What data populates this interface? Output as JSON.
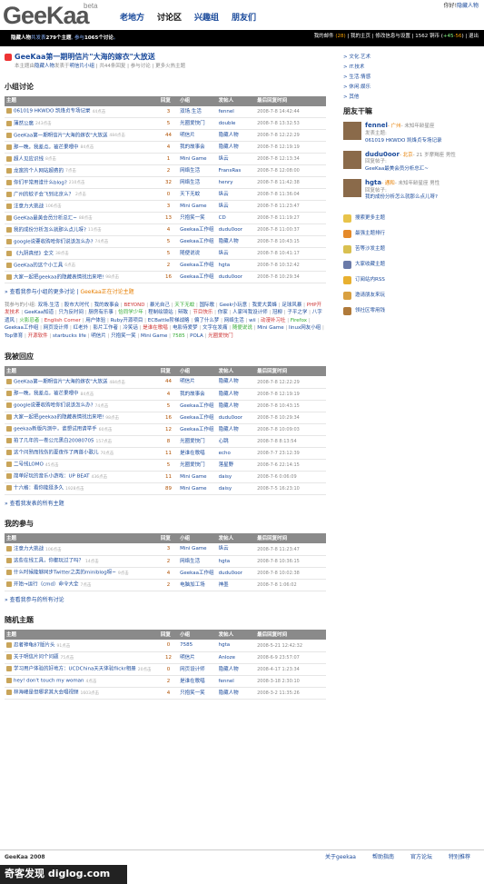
{
  "header": {
    "logo": "GeeKaa",
    "beta": "beta",
    "nav": [
      "老地方",
      "讨论区",
      "兴趣组",
      "朋友们"
    ],
    "greeting": "你好!",
    "user": "隐藏人物"
  },
  "userbar": {
    "left_user": "隐藏人物",
    "left_a": "共发表",
    "left_b": "279个主题",
    "left_c": ", 参与",
    "left_d": "1065个讨论",
    "left_e": "。",
    "mail": "我的邮件",
    "mail_count": "(28)",
    "links": "| 我的主页 | 修改信息与设置 | ",
    "coins": "1562",
    "coins_label": " 铜币 (",
    "delta": "+45",
    "delta2": "-56",
    "end": ") | 退出"
  },
  "topic": {
    "title": "GeeKaa第一期明信片\"大海的嫁衣\"大放送",
    "meta_prefix": "本主题由",
    "meta_user": "隐藏人物",
    "meta_in": "发表于",
    "meta_group": "明信片小组",
    "meta_rest": " | 共44条回复 | 参与讨论 | 更多火热主题"
  },
  "sections": {
    "group": "小组讨论",
    "replied": "我被回应",
    "joined": "我的参与",
    "random": "随机主题"
  },
  "columns": [
    "主题",
    "回复",
    "小组",
    "发帖人",
    "最后回复时间"
  ],
  "group_rows": [
    [
      "061019 HKWDO 凯烽贞专场记录",
      "44点击",
      "3",
      "双场.生活",
      "fennel",
      "2008-7-8 14:42:44"
    ],
    [
      "薄然公腐",
      "243点击",
      "5",
      "光圈爱快门",
      "double",
      "2008-7-8 13:32:53"
    ],
    [
      "GeeKaa第一期明信片\"大海的嫁衣\"大放送",
      "484点击",
      "44",
      "明信片",
      "隐藏人物",
      "2008-7-8 12:22:29"
    ],
    [
      "那一晚，我差点。被芒果喂中",
      "84点击",
      "4",
      "我的故事会",
      "隐藏人物",
      "2008-7-8 12:19:19"
    ],
    [
      "超人见应识线",
      "8点击",
      "1",
      "Mini Game",
      "纵云",
      "2008-7-8 12:13:34"
    ],
    [
      "龙宽的个人网站超费的",
      "7点击",
      "2",
      "网络生活",
      "FransRas",
      "2008-7-8 12:08:00"
    ],
    [
      "你们平常用谁什么blog?",
      "210点击",
      "32",
      "网络生活",
      "henry",
      "2008-7-8 11:42:38"
    ],
    [
      "广州的蚊子会飞到北京么？",
      "2点击",
      "0",
      "天下无蚊",
      "纵云",
      "2008-7-8 11:36:04"
    ],
    [
      "注意力大挑战",
      "106点击",
      "3",
      "Mini Game",
      "纵云",
      "2008-7-8 11:23:47"
    ],
    [
      "GeeKaa最美会员分析总汇~",
      "88点击",
      "13",
      "只抱笑一笑",
      "CD",
      "2008-7-8 11:19:27"
    ],
    [
      "我的成份分析怎么就那么点儿呀?",
      "11点击",
      "4",
      "Geekaa工作组",
      "dudu0oor",
      "2008-7-8 11:00:37"
    ],
    [
      "google说要收购哈你们说该怎么办?",
      "74点击",
      "5",
      "Geekaa工作组",
      "隐藏人物",
      "2008-7-8 10:43:15"
    ],
    [
      "《九阴真经》全文",
      "38点击",
      "5",
      "随便说说",
      "纵云",
      "2008-7-8 10:41:17"
    ],
    [
      "GeeKaa的这个小工具",
      "6点击",
      "2",
      "Geekaa工作组",
      "hgta",
      "2008-7-8 10:32:42"
    ],
    [
      "大家一起把geekaa的隐藏表情找出来吧!",
      "98点击",
      "16",
      "Geekaa工作组",
      "dudu0oor",
      "2008-7-8 10:29:34"
    ]
  ],
  "group_more": "查看我参与小组的更多讨论",
  "group_link": "GeeKaa正在讨论主题",
  "tags": {
    "label": "我参与的小组:",
    "items": [
      "双场.生活",
      "股市大时代",
      "我的故事会",
      "BEYOND",
      "暴光自己",
      "天下无蚊",
      "国际歌",
      "Geek小玩意",
      "我爱大黄蜂",
      "足球风暴",
      "PHP开发技术",
      "GeeKaa知道",
      "只为反时间",
      "厨房有乐事",
      "恰同学少年",
      "程制绘镜站",
      "辩致",
      "节目快乐",
      "你家",
      "人家叫我设计师",
      "冠柳",
      "子平之学",
      "八字遗风",
      "火影忍者",
      "English Corner",
      "用户体验",
      "Ruby开源项目",
      "ECBattle阶梯战略",
      "偏了什么梦",
      "网络生活",
      "wii",
      "动漫补习社",
      "Firefox",
      "Geekaa工作组",
      "网页设计师",
      "红老外",
      "影片工作者",
      "冷笑话",
      "是谁在歌唱",
      "电影侍爱梦",
      "文字在发痛",
      "随便说说",
      "Mini Game",
      "linux网友小组",
      "Top体育",
      "开源软件",
      "starbucks life",
      "明信片",
      "只抱笑一笑",
      "Mini Game",
      "7585",
      "POLA",
      "光圈爱快门"
    ]
  },
  "replied_rows": [
    [
      "GeeKaa第一期明信片\"大海的嫁衣\"大放送",
      "484点击",
      "44",
      "明信片",
      "隐藏人物",
      "2008-7-8 12:22:29"
    ],
    [
      "那一晚，我差点。被芒果喂中",
      "84点击",
      "4",
      "我的故事会",
      "隐藏人物",
      "2008-7-8 12:19:19"
    ],
    [
      "google说要收购哈你们说该怎么办?",
      "74点击",
      "5",
      "Geekaa工作组",
      "隐藏人物",
      "2008-7-8 10:43:15"
    ],
    [
      "大家一起把geekaa的隐藏表情找出来吧!",
      "98点击",
      "16",
      "Geekaa工作组",
      "dudu0oor",
      "2008-7-8 10:29:34"
    ],
    [
      "geekaa新版内测中，谁想试用请举手",
      "60点击",
      "12",
      "Geekaa工作组",
      "隐藏人物",
      "2008-7-8 10:09:03"
    ],
    [
      "拍了几年的一卷公元黑白20080705",
      "157点击",
      "8",
      "光圈爱快门",
      "心跳",
      "2008-7-8 8:13:54"
    ],
    [
      "这个问熟而找伤的夏夜作了两首小歌儿",
      "70点击",
      "11",
      "是谁在歌唱",
      "echo",
      "2008-7-7 23:12:39"
    ],
    [
      "二号线LOMO",
      "45点击",
      "5",
      "光圈爱快门",
      "落星野",
      "2008-7-6 22:14:15"
    ],
    [
      "简单好玩的音乐小游戏：UP BEAT",
      "436点击",
      "11",
      "Mini Game",
      "daisy",
      "2008-7-6 0:06:09"
    ],
    [
      "十六格：看你能挺多久",
      "1928点击",
      "89",
      "Mini Game",
      "daisy",
      "2008-7-5 16:23:10"
    ]
  ],
  "replied_more": "查看我发表的所有主题",
  "joined_rows": [
    [
      "注意力大挑战",
      "106点击",
      "3",
      "Mini Game",
      "纵云",
      "2008-7-8 11:23:47"
    ],
    [
      "这些在线工具，你都玩过了吗？",
      "14点击",
      "2",
      "网络生活",
      "hgta",
      "2008-7-8 10:36:15"
    ],
    [
      "什么时候能够同步Twitter之类的miniblog呀~",
      "9点击",
      "4",
      "Geekaa工作组",
      "dudu0oor",
      "2008-7-8 10:02:38"
    ],
    [
      "开始→运行（cmd）命令大全",
      "7点击",
      "2",
      "电脑加工场",
      "神墨",
      "2008-7-8 1:06:02"
    ]
  ],
  "joined_more": "查看我参与的所有讨论",
  "random_rows": [
    [
      "忍者神龟87版片头",
      "91点击",
      "0",
      "7585",
      "hgta",
      "2008-5-21 12:42:32"
    ],
    [
      "关于明信片问个问题",
      "75点击",
      "12",
      "明信片",
      "Anloze",
      "2008-6-9 23:57:07"
    ],
    [
      "学习用户体验的好地方：UCDChina天天体验flickr相册",
      "20点击",
      "0",
      "网页设计师",
      "隐藏人物",
      "2008-4-17 1:23:34"
    ],
    [
      "hey! don't touch my woman",
      "4点击",
      "2",
      "是谁在歌唱",
      "fennel",
      "2008-3-18 2:30:10"
    ],
    [
      "林海峰是但哪求其大会唱视频",
      "1603点击",
      "4",
      "只抱笑一笑",
      "隐藏人物",
      "2008-3-2 11:35:26"
    ]
  ],
  "sidebar": {
    "categories": [
      "> 文化.艺术",
      "> IT.技术",
      "> 生活.情感",
      "> 休闲.娱乐",
      "> 其他"
    ],
    "friends_title": "朋友干嘛",
    "friends": [
      {
        "name": "fennel",
        "loc": "- 广州",
        "info": "- 未知年龄星座",
        "act": "发表主题:",
        "topic": "061019 HKWDO 凯烽贞专场记录"
      },
      {
        "name": "dudu0oor",
        "loc": "- 北京",
        "info": "- 21 岁摩羯座 男性",
        "act": "回复帖子:",
        "topic": "GeeKaa最美会员分析总汇~"
      },
      {
        "name": "hgta",
        "loc": "- 通和",
        "info": "- 未知年龄星座 男性",
        "act": "回复帖子:",
        "topic": "我的成份分析怎么就那么点儿呀?"
      }
    ],
    "links": [
      "搜索更多主题",
      "最强主题排行",
      "苦等沙发主题",
      "大家收藏主题",
      "订阅站内RSS",
      "邀请朋友来玩",
      "领社区零用钱"
    ],
    "link_colors": [
      "#e8c34a",
      "#e58a2a",
      "#d9c050",
      "#6a7aa8",
      "#e8b030",
      "#d9a040",
      "#b07a3a"
    ]
  },
  "footer": {
    "copy": "GeeKaa 2008",
    "links": [
      "关于geekaa",
      "帮助指南",
      "官方论坛",
      "特别推荐"
    ]
  },
  "watermark": "奇客发现 diglog.com"
}
